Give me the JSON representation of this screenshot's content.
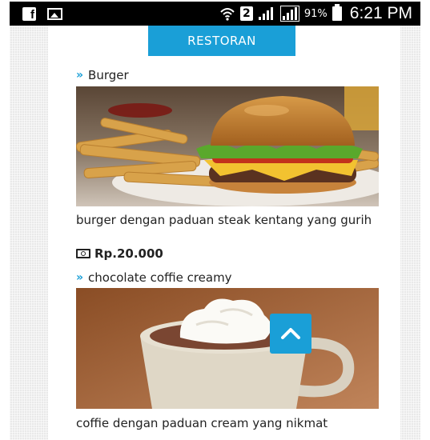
{
  "status_bar": {
    "fb_glyph": "f",
    "sim_label": "2",
    "battery_percent": "91%",
    "time": "6:21 PM"
  },
  "header": {
    "title": "RESTORAN"
  },
  "items": [
    {
      "name": "Burger",
      "description": "burger dengan paduan steak kentang yang gurih",
      "price": "Rp.20.000"
    },
    {
      "name": "chocolate coffie creamy",
      "description": "coffie dengan paduan cream yang nikmat"
    }
  ],
  "colors": {
    "accent": "#1a9fd7"
  },
  "icons": {
    "bullet": "double-chevron-right-icon",
    "price": "money-icon",
    "scroll": "chevron-up-icon"
  }
}
